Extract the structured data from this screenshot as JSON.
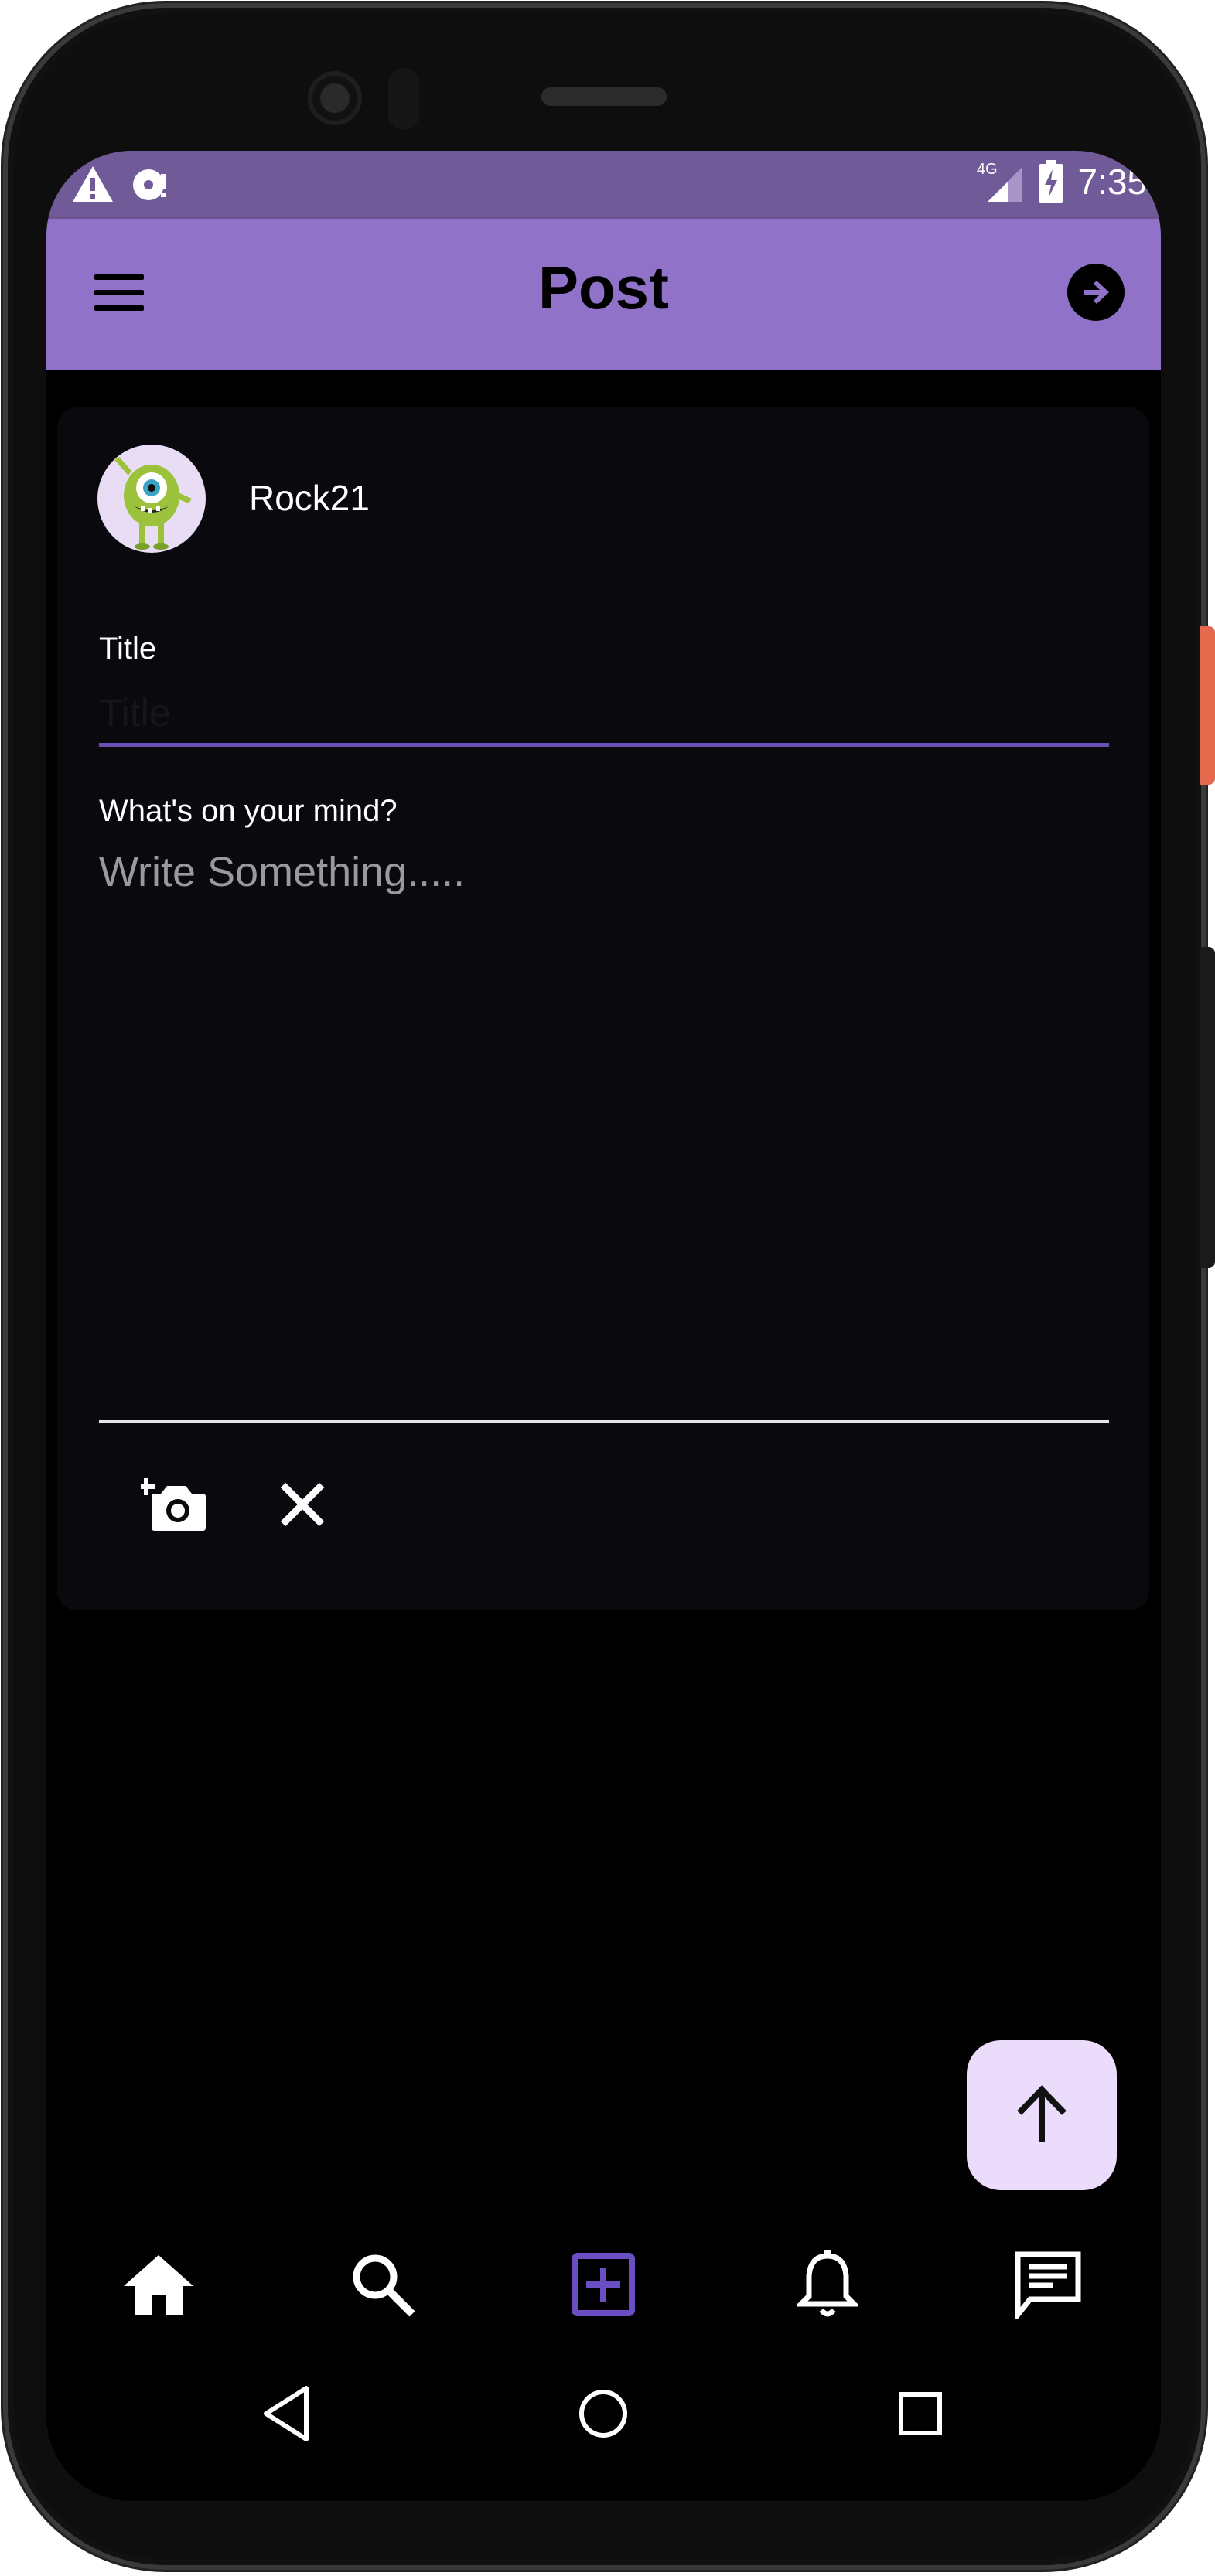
{
  "status_bar": {
    "time": "7:35",
    "network": "4G",
    "left_icons": [
      "alert-icon",
      "disc-icon"
    ],
    "colors": {
      "background": "#715a98"
    }
  },
  "app_bar": {
    "title": "Post",
    "menu_icon": "menu-icon",
    "action_icon": "arrow-right-circle-icon",
    "colors": {
      "background": "#9073c8"
    }
  },
  "post_card": {
    "username": "Rock21",
    "title_label": "Title",
    "title_placeholder": "Title",
    "title_value": "",
    "body_label": "What's on your mind?",
    "body_placeholder": "Write Something.....",
    "body_value": "",
    "actions": [
      "add-photo-icon",
      "close-icon"
    ],
    "colors": {
      "accent": "#6a4fb5",
      "card": "#0a090e"
    }
  },
  "fab": {
    "icon": "arrow-up-icon",
    "colors": {
      "background": "#eadcfa"
    }
  },
  "bottom_nav": {
    "items": [
      {
        "icon": "home-icon",
        "active": false
      },
      {
        "icon": "search-icon",
        "active": false
      },
      {
        "icon": "add-box-icon",
        "active": true
      },
      {
        "icon": "bell-icon",
        "active": false
      },
      {
        "icon": "chat-icon",
        "active": false
      }
    ],
    "colors": {
      "active": "#6a4fc4",
      "inactive": "#ffffff"
    }
  },
  "system_nav": [
    "back-icon",
    "home-circle-icon",
    "recents-icon"
  ]
}
